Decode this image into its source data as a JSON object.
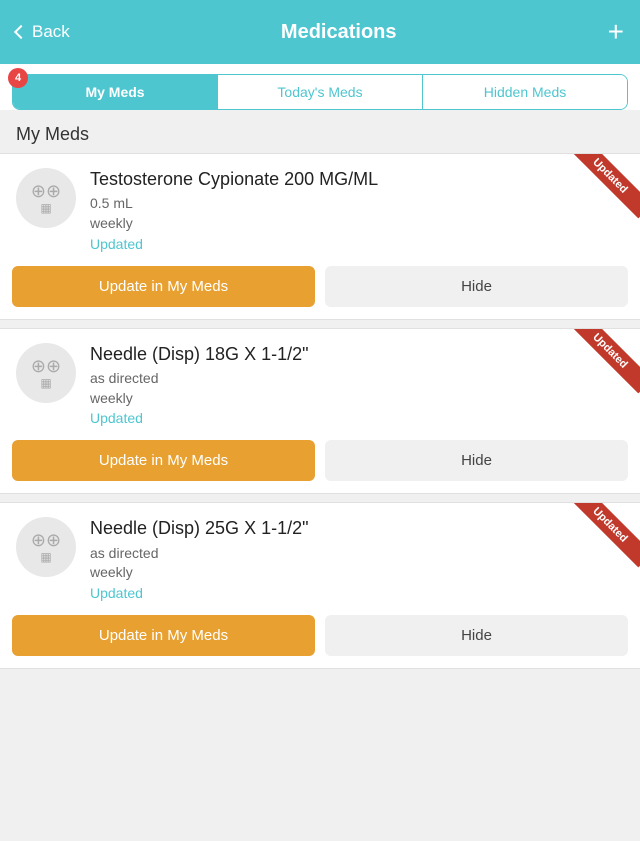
{
  "header": {
    "back_label": "Back",
    "title": "Medications",
    "add_label": "+"
  },
  "badge": {
    "count": "4"
  },
  "tabs": [
    {
      "id": "my-meds",
      "label": "My Meds",
      "active": true
    },
    {
      "id": "todays-meds",
      "label": "Today's Meds",
      "active": false
    },
    {
      "id": "hidden-meds",
      "label": "Hidden Meds",
      "active": false
    }
  ],
  "section": {
    "title": "My Meds"
  },
  "medications": [
    {
      "name": "Testosterone Cypionate 200 MG/ML",
      "dose": "0.5 mL",
      "frequency": "weekly",
      "status": "Updated",
      "ribbon": "Updated",
      "update_btn": "Update in My Meds",
      "hide_btn": "Hide"
    },
    {
      "name": "Needle (Disp) 18G X 1-1/2\"",
      "dose": "as directed",
      "frequency": "weekly",
      "status": "Updated",
      "ribbon": "Updated",
      "update_btn": "Update in My Meds",
      "hide_btn": "Hide"
    },
    {
      "name": "Needle (Disp) 25G X 1-1/2\"",
      "dose": "as directed",
      "frequency": "weekly",
      "status": "Updated",
      "ribbon": "Updated",
      "update_btn": "Update in My Meds",
      "hide_btn": "Hide"
    }
  ],
  "icons": {
    "pill": "💊",
    "camera": "📷",
    "chevron_left": "‹"
  },
  "colors": {
    "teal": "#4ec6d0",
    "orange": "#e8a030",
    "red_ribbon": "#c0392b",
    "badge_red": "#e84545"
  }
}
